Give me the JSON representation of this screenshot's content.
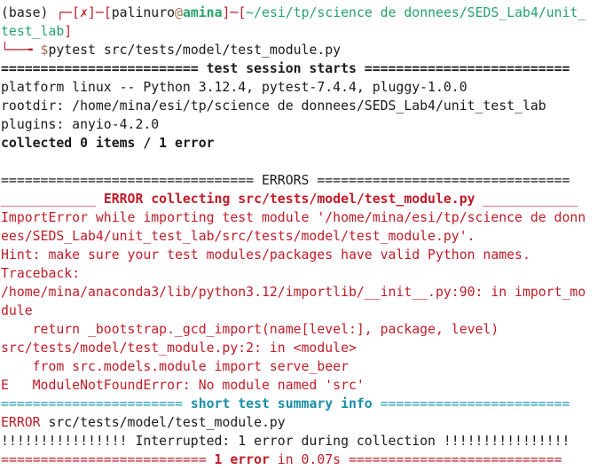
{
  "prompt": {
    "env": "(base) ",
    "frame1": "┌─[",
    "fail_mark": "✗",
    "frame2": "]─[",
    "user": "palinuro",
    "at": "@",
    "host": "amina",
    "frame3": "]─[",
    "path_part1": "~/esi/tp/science de donnees/SEDS_Lab4/unit_",
    "path_part2": "test_lab",
    "frame4": "]",
    "corner": "└──╼ ",
    "dollar": "$",
    "command": "pytest src/tests/model/test_module.py"
  },
  "session": {
    "header": "========================= test session starts ==========================",
    "platform": "platform linux -- Python 3.12.4, pytest-7.4.4, pluggy-1.0.0",
    "rootdir": "rootdir: /home/mina/esi/tp/science de donnees/SEDS_Lab4/unit_test_lab",
    "plugins": "plugins: anyio-4.2.0",
    "collected": "collected 0 items / 1 error"
  },
  "errors": {
    "header_left": "================================ ",
    "header_title": "ERRORS",
    "header_right": " ================================",
    "collect_left": "____________ ",
    "collect_title": "ERROR collecting src/tests/model/test_module.py",
    "collect_right": " ____________",
    "lines": [
      "ImportError while importing test module '/home/mina/esi/tp/science de donn",
      "ees/SEDS_Lab4/unit_test_lab/src/tests/model/test_module.py'.",
      "Hint: make sure your test modules/packages have valid Python names.",
      "Traceback:",
      "/home/mina/anaconda3/lib/python3.12/importlib/__init__.py:90: in import_mo",
      "dule",
      "    return _bootstrap._gcd_import(name[level:], package, level)",
      "src/tests/model/test_module.py:2: in <module>",
      "    from src.models.module import serve_beer",
      "E   ModuleNotFoundError: No module named 'src'"
    ]
  },
  "summary": {
    "header_left": "======================= ",
    "header_title": "short test summary info",
    "header_right": " ========================",
    "error_word": "ERROR",
    "error_rest": " src/tests/model/test_module.py",
    "interrupted": "!!!!!!!!!!!!!!!! Interrupted: 1 error during collection !!!!!!!!!!!!!!!!",
    "final_left": "========================== ",
    "final_count": "1 error",
    "final_time": " in 0.07s",
    "final_right": " ==========================="
  }
}
